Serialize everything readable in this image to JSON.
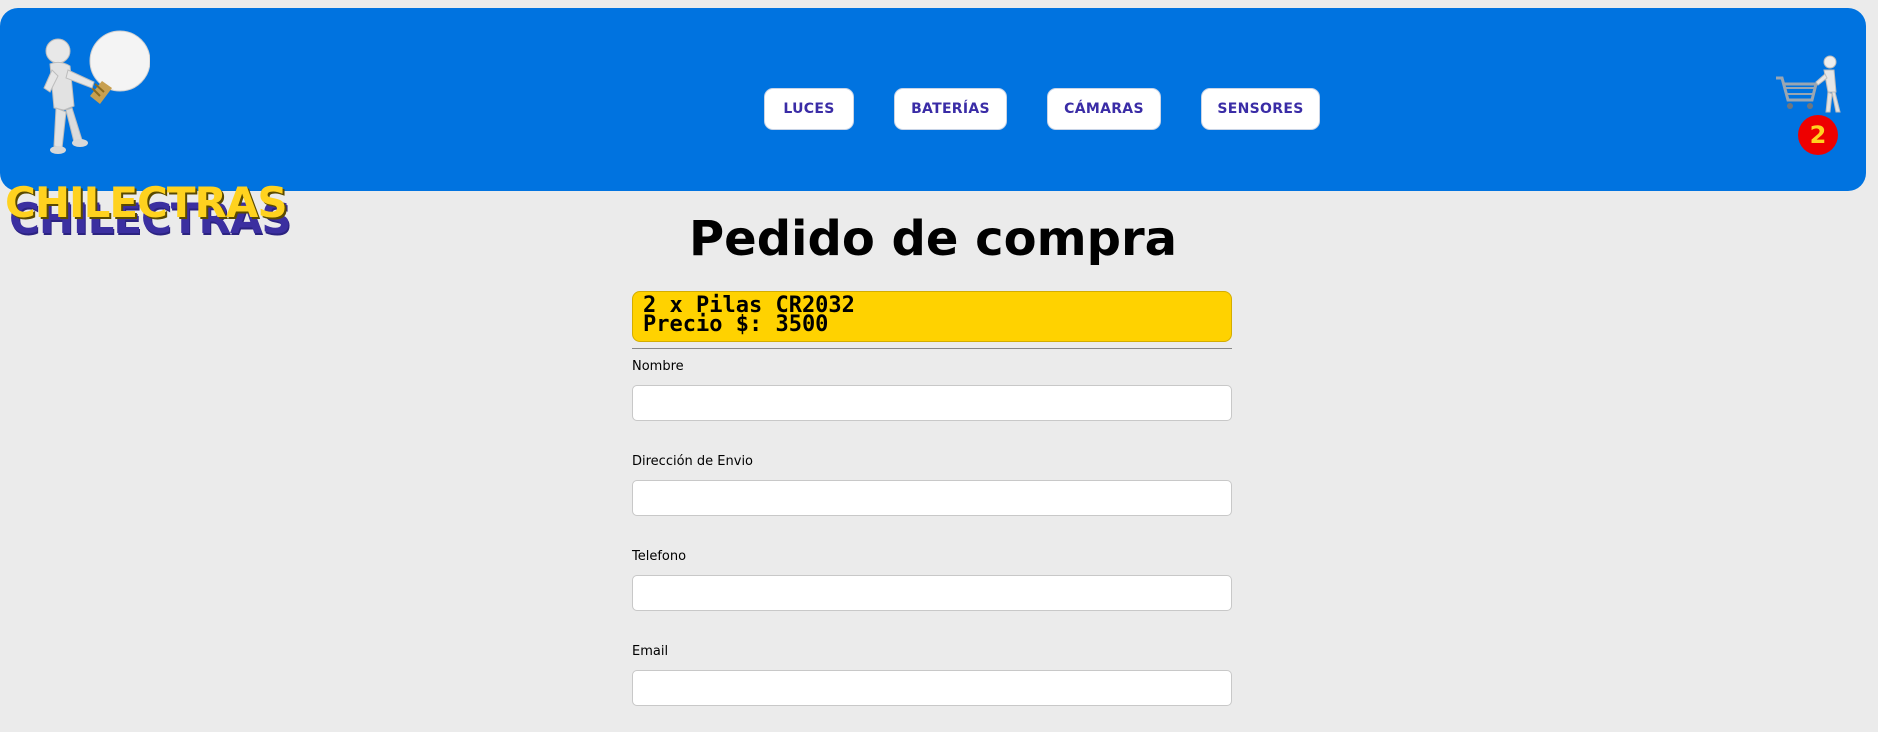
{
  "header": {
    "brand": "CHILECTRAS",
    "nav": [
      {
        "label": "LUCES"
      },
      {
        "label": "BATERÍAS"
      },
      {
        "label": "CÁMARAS"
      },
      {
        "label": "SENSORES"
      }
    ],
    "cart_count": "2",
    "logo_icon": "lightbulb-figure-icon",
    "cart_icon": "shopping-cart-figure-icon"
  },
  "main": {
    "title": "Pedido de compra",
    "order": {
      "item_line": "2 x Pilas CR2032",
      "price_line": "Precio $: 3500"
    },
    "form": {
      "fields": [
        {
          "label": "Nombre",
          "value": "",
          "placeholder": ""
        },
        {
          "label": "Dirección de Envio",
          "value": "",
          "placeholder": ""
        },
        {
          "label": "Telefono",
          "value": "",
          "placeholder": ""
        },
        {
          "label": "Email",
          "value": "",
          "placeholder": ""
        }
      ]
    }
  },
  "colors": {
    "header_bg": "#0073e0",
    "brand_text": "#ffd21f",
    "nav_text": "#3a2ca6",
    "order_bg": "#ffd200",
    "badge_bg": "#ee0000",
    "page_bg": "#ebebeb"
  }
}
